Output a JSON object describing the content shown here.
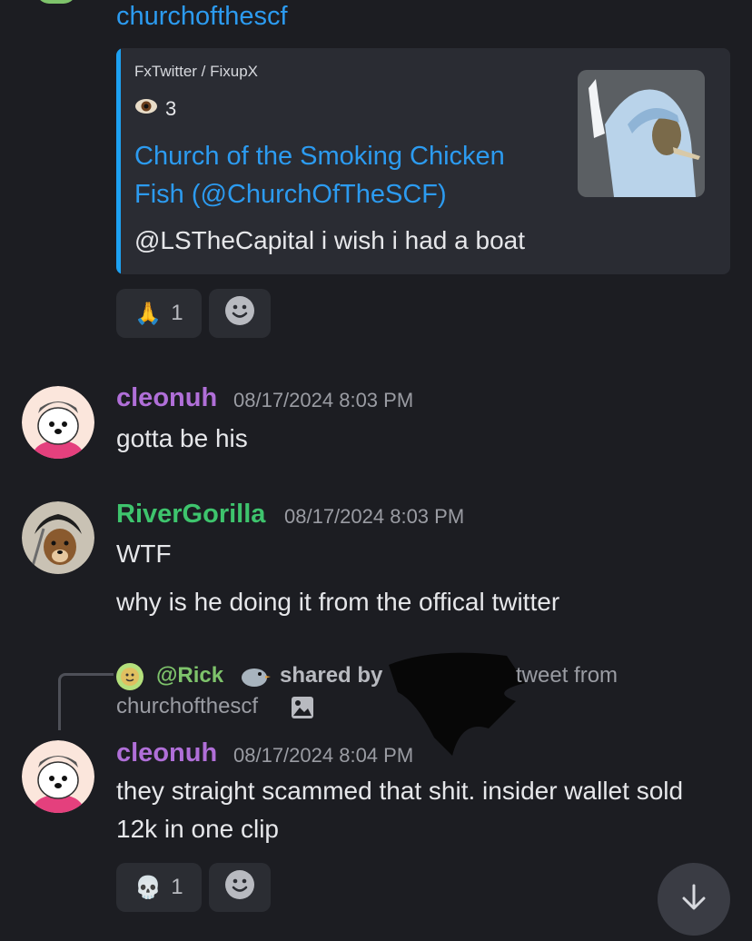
{
  "top_author": "churchofthescf",
  "embed": {
    "provider": "FxTwitter / FixupX",
    "views": "3",
    "title": "Church of the Smoking Chicken Fish (@ChurchOfTheSCF)",
    "description": "@LSTheCapital i wish i had a boat"
  },
  "reactions_1": [
    {
      "emoji": "🙏",
      "count": "1"
    }
  ],
  "messages": [
    {
      "author": "cleonuh",
      "author_color": "#b06fd8",
      "timestamp": "08/17/2024 8:03 PM",
      "lines": [
        "gotta be his"
      ]
    },
    {
      "author": "RiverGorilla",
      "author_color": "#3ec46d",
      "timestamp": "08/17/2024 8:03 PM",
      "lines": [
        "WTF",
        "why is he doing it from the offical twitter"
      ]
    },
    {
      "author": "cleonuh",
      "author_color": "#b06fd8",
      "timestamp": "08/17/2024 8:04 PM",
      "text": "they straight scammed that shit. insider wallet sold 12k in one clip"
    }
  ],
  "reply_preview": {
    "mention": "@Rick",
    "shared_by": "shared by",
    "tail": "tweet from",
    "source": "churchofthescf"
  },
  "reactions_2": [
    {
      "emoji": "💀",
      "count": "1"
    }
  ],
  "colors": {
    "link": "#2c9bf0",
    "background": "#1c1d22",
    "embed_bg": "#2a2c33"
  }
}
